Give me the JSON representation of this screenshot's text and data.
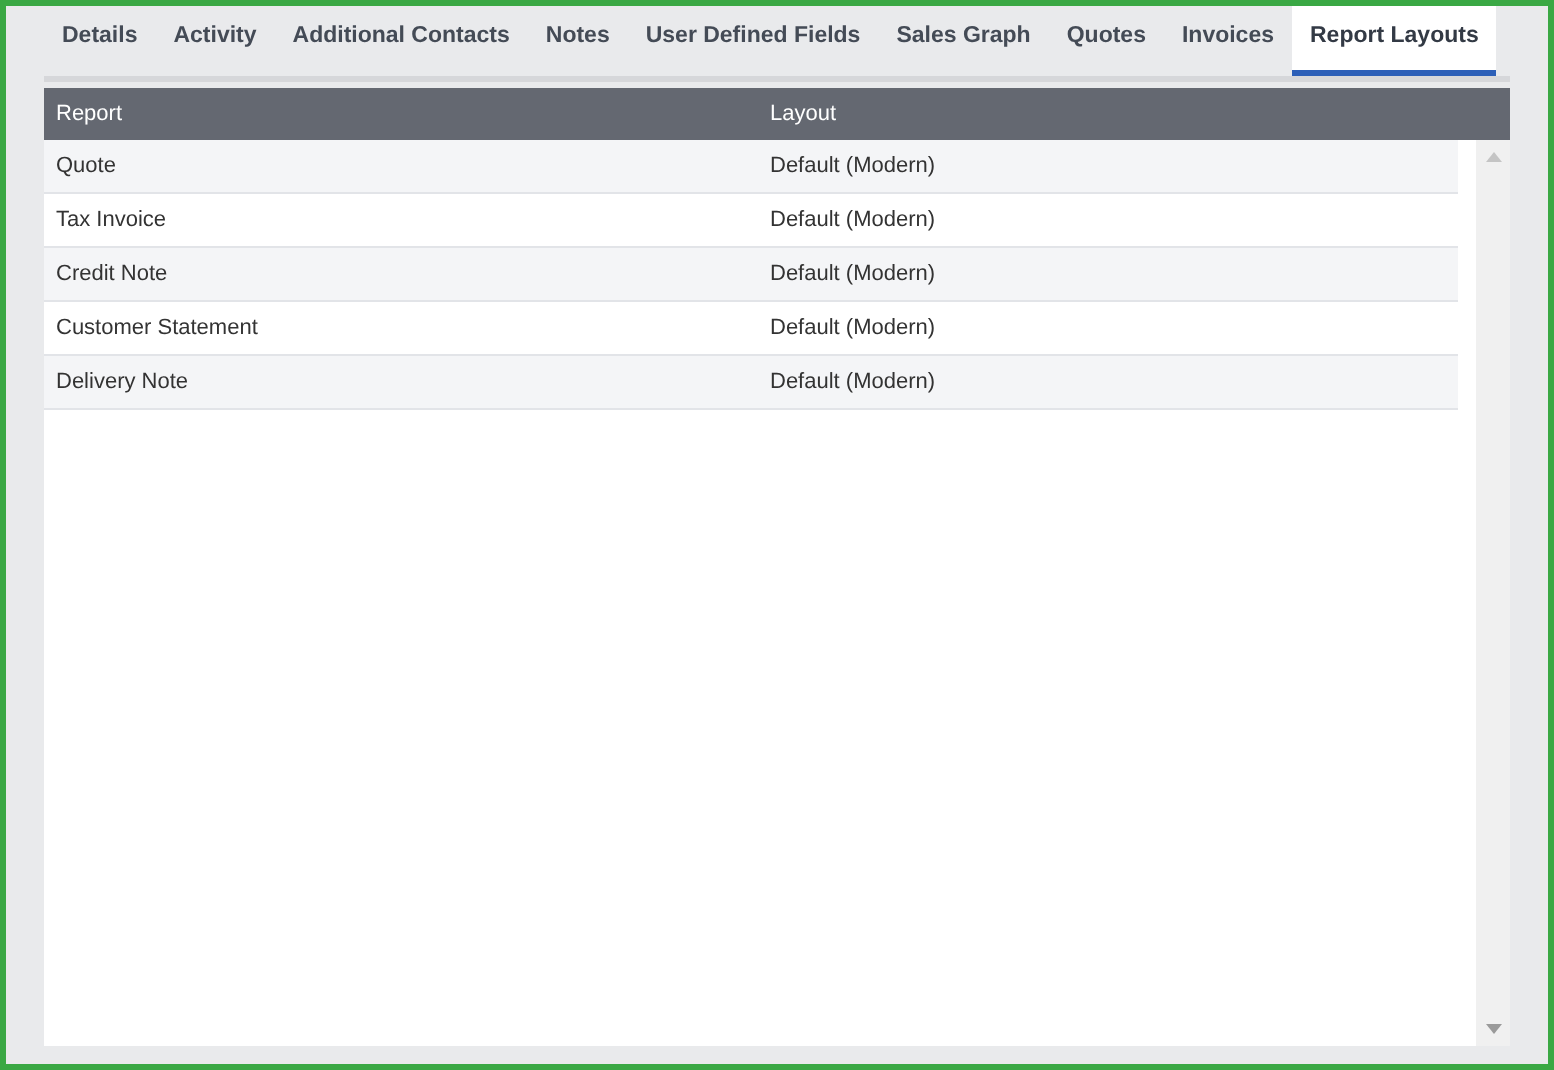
{
  "tabs": [
    {
      "label": "Details",
      "selected": false
    },
    {
      "label": "Activity",
      "selected": false
    },
    {
      "label": "Additional Contacts",
      "selected": false
    },
    {
      "label": "Notes",
      "selected": false
    },
    {
      "label": "User Defined Fields",
      "selected": false
    },
    {
      "label": "Sales Graph",
      "selected": false
    },
    {
      "label": "Quotes",
      "selected": false
    },
    {
      "label": "Invoices",
      "selected": false
    },
    {
      "label": "Report Layouts",
      "selected": true
    }
  ],
  "table": {
    "columns": [
      "Report",
      "Layout"
    ],
    "rows": [
      [
        "Quote",
        "Default (Modern)"
      ],
      [
        "Tax Invoice",
        "Default (Modern)"
      ],
      [
        "Credit Note",
        "Default (Modern)"
      ],
      [
        "Customer Statement",
        "Default (Modern)"
      ],
      [
        "Delivery Note",
        "Default (Modern)"
      ]
    ]
  }
}
